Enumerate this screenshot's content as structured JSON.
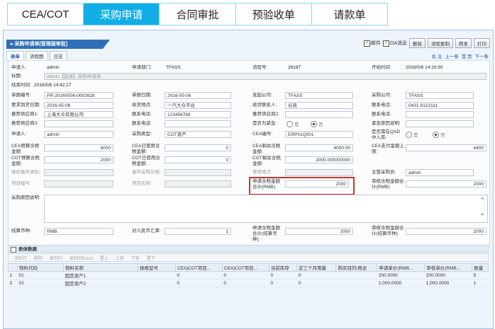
{
  "tabs": [
    {
      "label": "CEA/COT",
      "active": false
    },
    {
      "label": "采购申请",
      "active": true
    },
    {
      "label": "合同审批",
      "active": false
    },
    {
      "label": "预验收单",
      "active": false
    },
    {
      "label": "请款单",
      "active": false
    }
  ],
  "window": {
    "title": "采购申请单[管理层审批]"
  },
  "top_options": {
    "mail_label": "邮件",
    "oa_label": "OA消息",
    "delete": "删除",
    "copy": "流程复制",
    "forward": "转发",
    "print": "打印"
  },
  "subtabs": [
    "表单",
    "流程图",
    "日志"
  ],
  "pager": [
    "关 注",
    "上一条",
    "首 页",
    "下一条"
  ],
  "form": {
    "applicant_label": "申请人:",
    "applicant": "admin",
    "dept_label": "申请部门:",
    "dept": "TFASS",
    "flow_no_label": "流程号:",
    "flow_no": "26187",
    "start_label": "开始时间:",
    "start": "2016/5/6 14:10:30",
    "title_label": "标题:",
    "title": "admin【起草】采购申请单",
    "end_label": "结束时间:",
    "end": "2016/5/6 14:42:27",
    "doc_no_label": "单据编号:",
    "doc_no": "PR-20160506-0002628",
    "doc_date_label": "单据日期:",
    "doc_date": "2016-05-06",
    "company_label": "发起公司:",
    "company": "TFASS",
    "company2_label": "采购公司:",
    "company2": "TFASS",
    "req_date_label": "要求到货日期:",
    "req_date": "2016-05-06",
    "recv_addr_label": "收货地点:",
    "recv_addr": "一汽大众平台",
    "receiver_label": "收货联系人:",
    "receiver": "谷凯",
    "phone_label": "联系电话:",
    "phone": "0431-9123111",
    "sup1_label": "推荐供应商1:",
    "sup1": "上海大众有限公司",
    "contact_label": "联系电话:",
    "contact": "123456789",
    "sup2_label": "推荐供应商2:",
    "sup2": "",
    "contact2_label": "联系电话:",
    "contact2": "",
    "sup3_label": "推荐供应商3:",
    "sup3": "",
    "contact3_label": "联系电话:",
    "contact3": "",
    "urgent_label": "是否为紧急:",
    "urgent_yes": "是",
    "urgent_no": "否",
    "urgent_desc_label": "紧急原因说明:",
    "urgent_desc": "",
    "applicant2_label": "申请人:",
    "applicant2": "admin",
    "ptype_label": "采购类型:",
    "ptype": "COT资产",
    "cea_no_label": "CEA编号:",
    "cea_no": "ERP01Q001",
    "qad_label": "是否需在QAD中入库:",
    "qad_yes": "是",
    "qad_no": "否",
    "cea_budget_label": "CEA预算含税金额:",
    "cea_budget": "4000",
    "cea_used_label": "CEA已使用含税金额:",
    "cea_used": "0",
    "cea_remain_label": "CEA剩余含税金额:",
    "cea_remain": "4000.00",
    "cea_pay_label": "CEA支付金额上限:",
    "cea_pay": "4400",
    "cot_budget_label": "COT预算含税金额:",
    "cot_budget": "2000",
    "cot_used_label": "COT已使用含税金额:",
    "cot_used": "0",
    "cot_remain_label": "COT剩余含税金额:",
    "cot_remain": "2000.000000000",
    "repair_label": "维修备件类别:",
    "repair": "",
    "spare_label": "备件采购分类:",
    "spare": "",
    "use_label": "使用地点:",
    "use": "",
    "mgr_label": "主管采购员:",
    "mgr": "admin",
    "proj_no_label": "项目编号:",
    "proj_no": "",
    "proj_name_label": "项目名称:",
    "proj_name": "",
    "req_total_label": "申请含税金额合计(RMB):",
    "req_total": "2000",
    "audit_total_label": "审核含税金额合计(RMB):",
    "audit_total": "2000",
    "reason_label": "采购原因说明:",
    "currency_label": "结算币种:",
    "currency": "RMB",
    "rate_label": "对人民币汇率:",
    "rate": "1",
    "req_total2_label": "申请含税金额合计(结算币种):",
    "req_total2": "2000",
    "audit_total2_label": "审核含税金额合计(结算币种):",
    "audit_total2": "2000"
  },
  "grid": {
    "title": "表体数据",
    "toolbar": [
      "添加行",
      "删除",
      "复制行",
      "复制到Excel",
      "置上",
      "上移",
      "下移",
      "置下"
    ],
    "headers": [
      "",
      "物料代码",
      "物料名称",
      "规格型号",
      "CEA|COT项目...",
      "CEA|COT项目...",
      "当前库存",
      "近三个月用量",
      "购买目的/用途",
      "申请单价(RMB...",
      "审核单价(RMB...",
      "数量"
    ],
    "rows": [
      [
        "1",
        "01",
        "固定资产1",
        "",
        "0",
        "0",
        "0",
        "0",
        "",
        "200.0000",
        "200.0000",
        "5"
      ],
      [
        "2",
        "02",
        "固定资产2",
        "",
        "0",
        "0",
        "0",
        "0",
        "",
        "1,000.0000",
        "1,000.0000",
        "1"
      ]
    ]
  }
}
